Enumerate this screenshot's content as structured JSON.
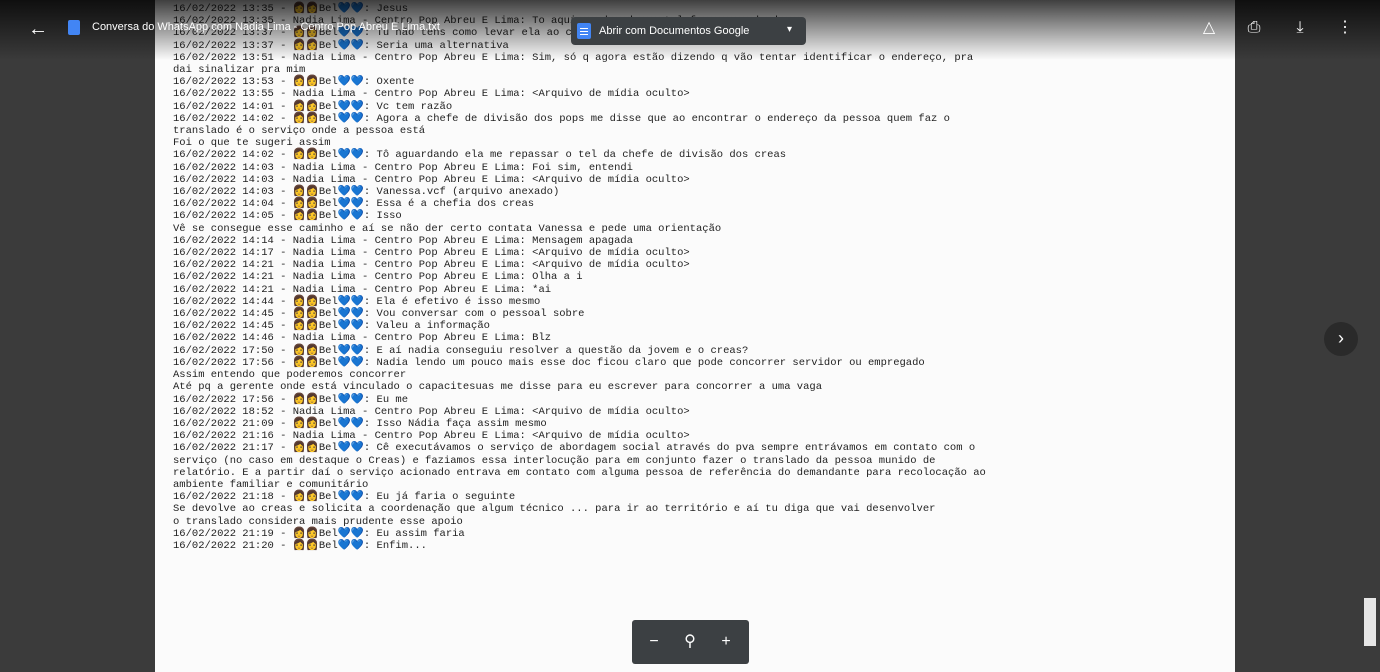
{
  "toolbar": {
    "doc_title": "Conversa do WhatsApp com Nadia Lima - Centro Pop Abreu E Lima.txt",
    "open_with_label": "Abrir com Documentos Google",
    "icons": [
      "back-arrow-icon",
      "docs-icon",
      "add-to-drive-icon",
      "print-icon",
      "download-icon",
      "more-vert-icon",
      "next-icon"
    ]
  },
  "document": {
    "lines": [
      "16/02/2022 13:35 - 👩👩Bel💙💙: Jesus",
      "16/02/2022 13:35 - Nadia Lima - Centro Pop Abreu E Lima: To aqui pendurada no telefone aguardando...",
      "16/02/2022 13:37 - 👩👩Bel💙💙: Tu não tens como levar ela ao cadas",
      "16/02/2022 13:37 - 👩👩Bel💙💙: Seria uma alternativa",
      "16/02/2022 13:51 - Nadia Lima - Centro Pop Abreu E Lima: Sim, só q agora estão dizendo q vão tentar identificar o endereço, pra",
      "dai sinalizar pra mim",
      "16/02/2022 13:53 - 👩👩Bel💙💙: Oxente",
      "16/02/2022 13:55 - Nadia Lima - Centro Pop Abreu E Lima: <Arquivo de mídia oculto>",
      "16/02/2022 14:01 - 👩👩Bel💙💙: Vc tem razão",
      "16/02/2022 14:02 - 👩👩Bel💙💙: Agora a chefe de divisão dos pops me disse que ao encontrar o endereço da pessoa quem faz o",
      "translado é o serviço onde a pessoa está",
      "Foi o que te sugeri assim",
      "16/02/2022 14:02 - 👩👩Bel💙💙: Tô aguardando ela me repassar o tel da chefe de divisão dos creas",
      "16/02/2022 14:03 - Nadia Lima - Centro Pop Abreu E Lima: Foi sim, entendi",
      "16/02/2022 14:03 - Nadia Lima - Centro Pop Abreu E Lima: <Arquivo de mídia oculto>",
      "16/02/2022 14:03 - 👩👩Bel💙💙: Vanessa.vcf (arquivo anexado)",
      "16/02/2022 14:04 - 👩👩Bel💙💙: Essa é a chefia dos creas",
      "16/02/2022 14:05 - 👩👩Bel💙💙: Isso",
      "Vê se consegue esse caminho e aí se não der certo contata Vanessa e pede uma orientação",
      "16/02/2022 14:14 - Nadia Lima - Centro Pop Abreu E Lima: Mensagem apagada",
      "16/02/2022 14:17 - Nadia Lima - Centro Pop Abreu E Lima: <Arquivo de mídia oculto>",
      "16/02/2022 14:21 - Nadia Lima - Centro Pop Abreu E Lima: <Arquivo de mídia oculto>",
      "16/02/2022 14:21 - Nadia Lima - Centro Pop Abreu E Lima: Olha a i",
      "16/02/2022 14:21 - Nadia Lima - Centro Pop Abreu E Lima: *ai",
      "16/02/2022 14:44 - 👩👩Bel💙💙: Ela é efetivo é isso mesmo",
      "16/02/2022 14:45 - 👩👩Bel💙💙: Vou conversar com o pessoal sobre",
      "16/02/2022 14:45 - 👩👩Bel💙💙: Valeu a informação",
      "16/02/2022 14:46 - Nadia Lima - Centro Pop Abreu E Lima: Blz",
      "16/02/2022 17:50 - 👩👩Bel💙💙: E aí nadia conseguiu resolver a questão da jovem e o creas?",
      "16/02/2022 17:56 - 👩👩Bel💙💙: Nadia lendo um pouco mais esse doc ficou claro que pode concorrer servidor ou empregado",
      "Assim entendo que poderemos concorrer",
      "Até pq a gerente onde está vinculado o capacitesuas me disse para eu escrever para concorrer a uma vaga",
      "16/02/2022 17:56 - 👩👩Bel💙💙: Eu me",
      "16/02/2022 18:52 - Nadia Lima - Centro Pop Abreu E Lima: <Arquivo de mídia oculto>",
      "16/02/2022 21:09 - 👩👩Bel💙💙: Isso Nádia faça assim mesmo",
      "16/02/2022 21:16 - Nadia Lima - Centro Pop Abreu E Lima: <Arquivo de mídia oculto>",
      "16/02/2022 21:17 - 👩👩Bel💙💙: Cê executávamos o serviço de abordagem social através do pva sempre entrávamos em contato com o",
      "serviço (no caso em destaque o Creas) e faziamos essa interlocução para em conjunto fazer o translado da pessoa munido de",
      "relatório. E a partir daí o serviço acionado entrava em contato com alguma pessoa de referência do demandante para recolocação ao",
      "ambiente familiar e comunitário",
      "16/02/2022 21:18 - 👩👩Bel💙💙: Eu já faria o seguinte",
      "Se devolve ao creas e solicita a coordenação que algum técnico ... para ir ao território e aí tu diga que vai desenvolver",
      "o translado considera mais prudente esse apoio",
      "16/02/2022 21:19 - 👩👩Bel💙💙: Eu assim faria",
      "16/02/2022 21:20 - 👩👩Bel💙💙: Enfim..."
    ]
  }
}
